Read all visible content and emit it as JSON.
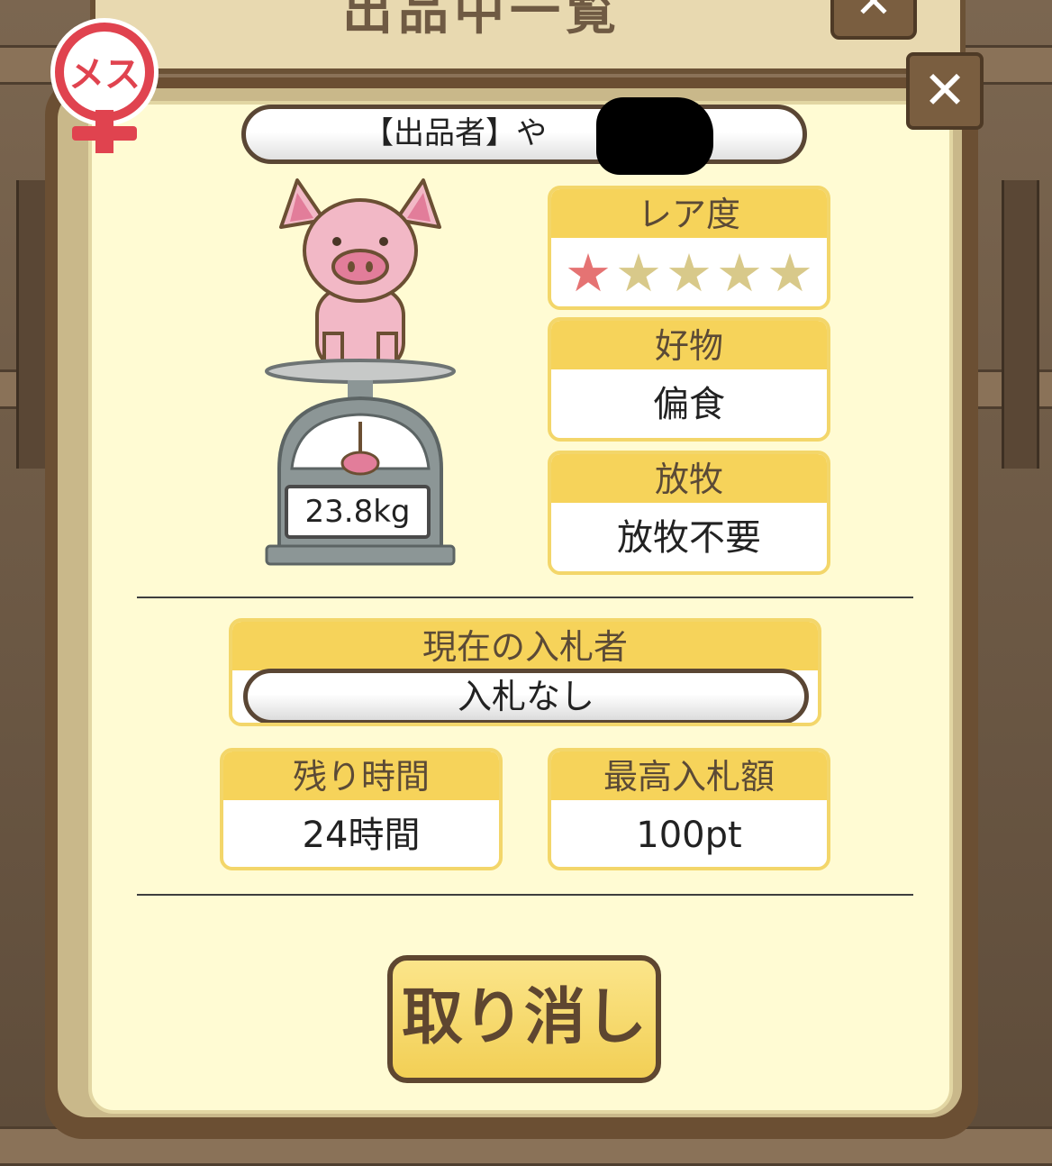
{
  "background": {
    "panel_title": "出品中一覧",
    "close_icon": "close-icon"
  },
  "gender_badge": {
    "label": "メス",
    "color": "#e0434f"
  },
  "close_button": {
    "label": "✕"
  },
  "seller": {
    "label": "【出品者】や"
  },
  "pig": {
    "weight": "23.8kg"
  },
  "rarity": {
    "title": "レア度",
    "rating": 1,
    "max": 5,
    "star_char": "★"
  },
  "favorite": {
    "title": "好物",
    "value": "偏食"
  },
  "grazing": {
    "title": "放牧",
    "value": "放牧不要"
  },
  "bidder": {
    "title": "現在の入札者",
    "value": "入札なし"
  },
  "remaining": {
    "title": "残り時間",
    "value": "24時間"
  },
  "highest_bid": {
    "title": "最高入札額",
    "value": "100pt"
  },
  "cancel_button": {
    "label": "取り消し"
  },
  "colors": {
    "header_yellow": "#f6d35a",
    "cream": "#fffbd3",
    "brown": "#6b4f33",
    "pig_pink": "#f2b8c6",
    "star_red": "#e57373"
  }
}
